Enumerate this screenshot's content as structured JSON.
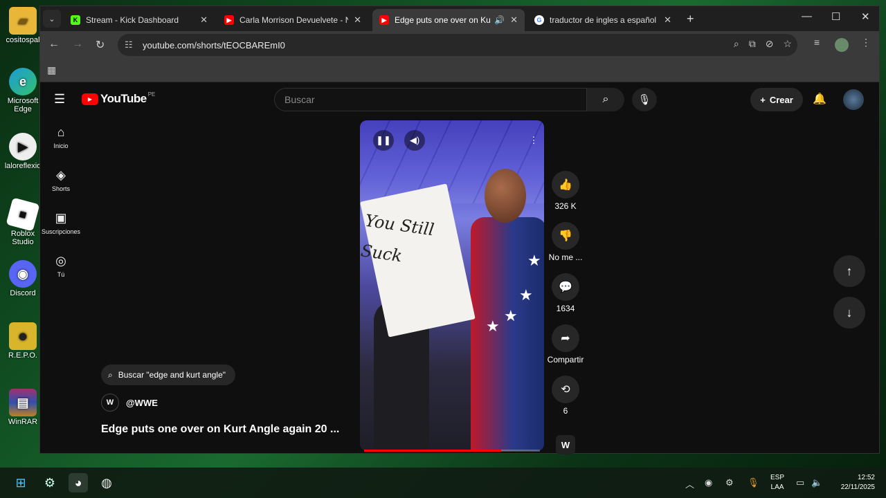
{
  "desktop": {
    "icons": [
      {
        "label": "cositospal",
        "icon": "folder-icon"
      },
      {
        "label": "Microsoft Edge",
        "icon": "edge-icon"
      },
      {
        "label": "laloreflexio",
        "icon": "media-icon"
      },
      {
        "label": "Roblox Studio",
        "icon": "roblox-icon"
      },
      {
        "label": "Discord",
        "icon": "discord-icon"
      },
      {
        "label": "R.E.P.O.",
        "icon": "repo-icon"
      },
      {
        "label": "WinRAR",
        "icon": "winrar-icon"
      }
    ]
  },
  "browser": {
    "tabs": [
      {
        "title": "Stream - Kick Dashboard",
        "favicon": "kick-icon",
        "active": false
      },
      {
        "title": "Carla Morrison Devuelvete - Na",
        "favicon": "youtube-icon",
        "active": false
      },
      {
        "title": "Edge puts one over on Kurt",
        "favicon": "youtube-icon",
        "active": true
      },
      {
        "title": "traductor de ingles a español -",
        "favicon": "google-icon",
        "active": false
      }
    ],
    "url": "youtube.com/shorts/tEOCBAREmI0"
  },
  "youtube": {
    "logo_text": "YouTube",
    "country_code": "PE",
    "search_placeholder": "Buscar",
    "create_label": "Crear",
    "guide": [
      {
        "label": "Inicio",
        "icon": "home-icon"
      },
      {
        "label": "Shorts",
        "icon": "shorts-icon"
      },
      {
        "label": "Suscripciones",
        "icon": "subscriptions-icon"
      },
      {
        "label": "Tú",
        "icon": "you-icon"
      }
    ],
    "video": {
      "sign_text": "You Still Suck",
      "progress": 0.78
    },
    "actions": {
      "likes": "326 K",
      "dislike_label": "No me ...",
      "comments": "1634",
      "share_label": "Compartir",
      "remix_count": "6"
    },
    "search_suggestion": "Buscar \"edge and kurt angle\"",
    "channel": "@WWE",
    "title": "Edge puts one over on Kurt Angle again 20 ..."
  },
  "taskbar": {
    "lang_top": "ESP",
    "lang_bottom": "LAA",
    "time": "12:52",
    "date": "22/11/2025"
  }
}
